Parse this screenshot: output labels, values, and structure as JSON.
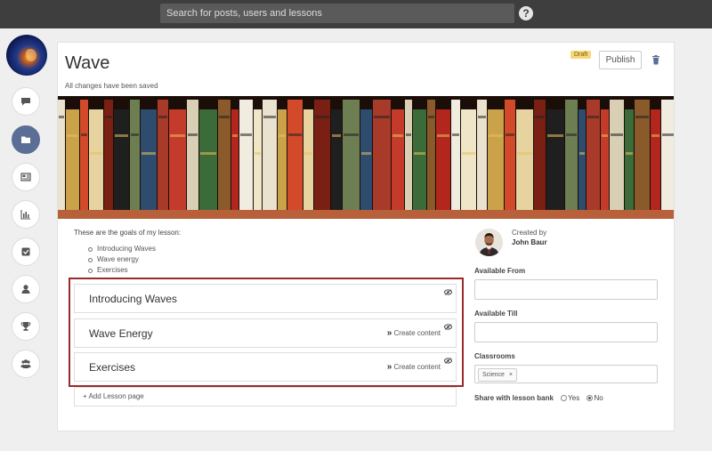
{
  "search": {
    "placeholder": "Search for posts, users and lessons"
  },
  "help_icon": "?",
  "sidebar": {
    "items": [
      {
        "icon": "comment-icon"
      },
      {
        "icon": "folder-icon",
        "active": true
      },
      {
        "icon": "newspaper-icon"
      },
      {
        "icon": "bar-chart-icon"
      },
      {
        "icon": "checkbox-icon"
      },
      {
        "icon": "user-icon"
      },
      {
        "icon": "trophy-icon"
      },
      {
        "icon": "group-icon"
      }
    ]
  },
  "lesson": {
    "title": "Wave",
    "save_status": "All changes have been saved",
    "status_badge": "Draft",
    "publish_label": "Publish",
    "goals_intro": "These are the goals of my lesson:",
    "goals": [
      "Introducing Waves",
      "Wave energy",
      "Exercises"
    ],
    "pages": [
      {
        "name": "Introducing Waves",
        "action": ""
      },
      {
        "name": "Wave Energy",
        "action": "Create content"
      },
      {
        "name": "Exercises",
        "action": "Create content"
      }
    ],
    "add_page_label": "+ Add Lesson page"
  },
  "details": {
    "created_by_label": "Created by",
    "author_name": "John Baur",
    "available_from_label": "Available From",
    "available_from_value": "",
    "available_till_label": "Available Till",
    "available_till_value": "",
    "classrooms_label": "Classrooms",
    "classroom_tag": "Science",
    "tag_remove": "×",
    "share_label": "Share with lesson bank",
    "share_options": [
      "Yes",
      "No"
    ],
    "share_selected": "No"
  },
  "colors": {
    "topbar": "#3e3e3e",
    "active_nav": "#5b6e95",
    "highlight_border": "#9b2a2a",
    "draft_badge": "#f6d77a"
  }
}
